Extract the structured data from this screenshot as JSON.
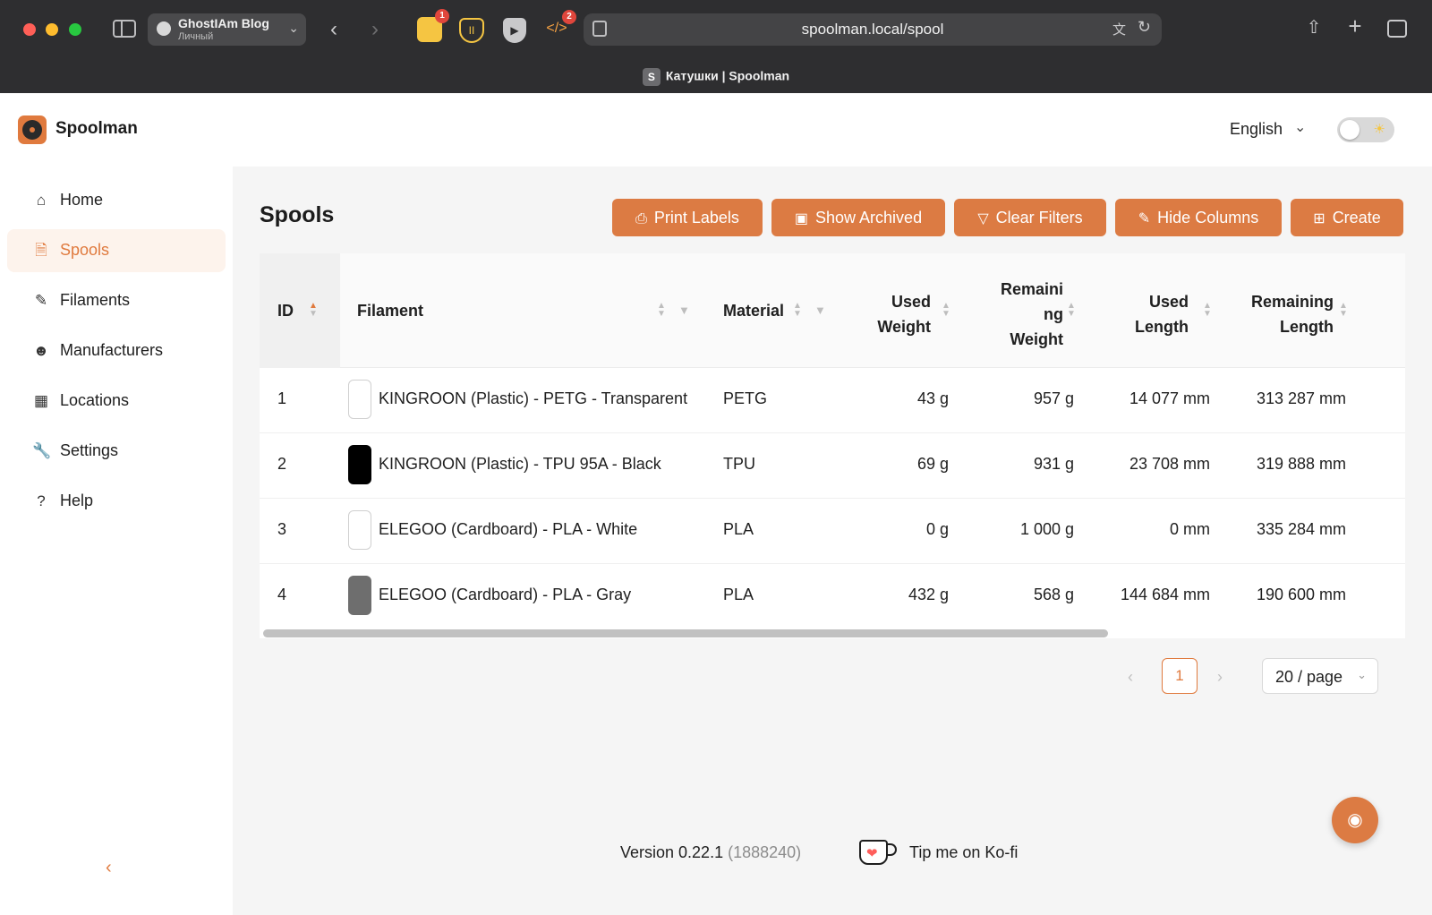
{
  "browser": {
    "profile_name": "GhostIAm Blog",
    "profile_sub": "Личный",
    "url": "spoolman.local/spool",
    "tab_title": "Катушки | Spoolman",
    "tab_favicon_letter": "S",
    "ext_badges": [
      "1",
      "2"
    ]
  },
  "header": {
    "brand": "Spoolman",
    "language": "English"
  },
  "sidebar": {
    "items": [
      {
        "label": "Home",
        "icon": "home-icon"
      },
      {
        "label": "Spools",
        "icon": "file-icon",
        "active": true
      },
      {
        "label": "Filaments",
        "icon": "highlighter-icon"
      },
      {
        "label": "Manufacturers",
        "icon": "user-icon"
      },
      {
        "label": "Locations",
        "icon": "table-icon"
      },
      {
        "label": "Settings",
        "icon": "tool-icon"
      },
      {
        "label": "Help",
        "icon": "question-icon"
      }
    ]
  },
  "page": {
    "title": "Spools",
    "buttons": {
      "print_labels": "Print Labels",
      "show_archived": "Show Archived",
      "clear_filters": "Clear Filters",
      "hide_columns": "Hide Columns",
      "create": "Create"
    }
  },
  "table": {
    "columns": {
      "id": "ID",
      "filament": "Filament",
      "material": "Material",
      "used_weight_1": "Used",
      "used_weight_2": "Weight",
      "rem_weight_1": "Remaini",
      "rem_weight_2": "ng",
      "rem_weight_3": "Weight",
      "used_length_1": "Used",
      "used_length_2": "Length",
      "rem_length_1": "Remaining",
      "rem_length_2": "Length"
    },
    "rows": [
      {
        "id": "1",
        "filament": "KINGROON (Plastic) - PETG - Transparent",
        "color": "#ffffff",
        "material": "PETG",
        "used_weight": "43 g",
        "remaining_weight": "957 g",
        "used_length": "14 077 mm",
        "remaining_length": "313 287 mm"
      },
      {
        "id": "2",
        "filament": "KINGROON (Plastic) - TPU 95A - Black",
        "color": "#000000",
        "material": "TPU",
        "used_weight": "69 g",
        "remaining_weight": "931 g",
        "used_length": "23 708 mm",
        "remaining_length": "319 888 mm"
      },
      {
        "id": "3",
        "filament": "ELEGOO (Cardboard) - PLA - White",
        "color": "#ffffff",
        "material": "PLA",
        "used_weight": "0 g",
        "remaining_weight": "1 000 g",
        "used_length": "0 mm",
        "remaining_length": "335 284 mm"
      },
      {
        "id": "4",
        "filament": "ELEGOO (Cardboard) - PLA - Gray",
        "color": "#6e6e6e",
        "material": "PLA",
        "used_weight": "432 g",
        "remaining_weight": "568 g",
        "used_length": "144 684 mm",
        "remaining_length": "190 600 mm"
      }
    ]
  },
  "pagination": {
    "current_page": "1",
    "page_size": "20 / page"
  },
  "footer": {
    "version": "Version 0.22.1",
    "commit": "(1888240)",
    "kofi": "Tip me on Ko-fi"
  },
  "colors": {
    "accent": "#dc7b43",
    "chrome_bg": "#2e2e30",
    "content_bg": "#f5f5f5"
  }
}
